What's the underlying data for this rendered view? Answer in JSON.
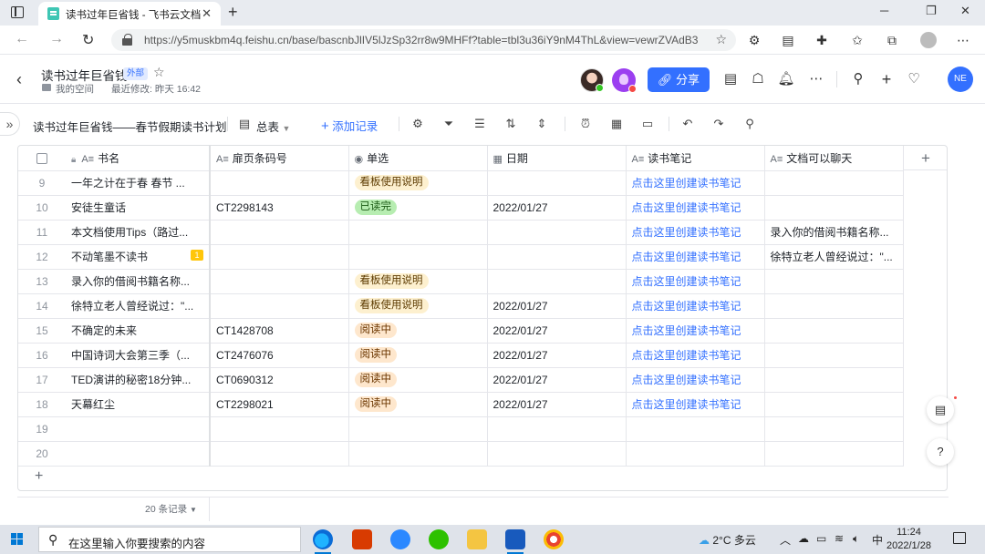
{
  "browser": {
    "tab_title": "读书过年巨省钱 - 飞书云文档",
    "tab_close": "✕",
    "new_tab": "+",
    "url_host": "https://y5muskbm4q.feishu.cn",
    "url_path": "/base/bascnbJlIV5lJzSp32rr8w9MHFf?table=tbl3u36iY9nM4ThL&view=vewrZVAdB3"
  },
  "header": {
    "title": "读书过年巨省钱",
    "badge": "外部",
    "location": "我的空间",
    "last_modified": "最近修改: 昨天 16:42",
    "share_label": "分享",
    "user_initials": "NE"
  },
  "toolbar": {
    "table_title": "读书过年巨省钱——春节假期读书计划",
    "view_name": "总表",
    "add_record": "添加记录"
  },
  "grid": {
    "columns": [
      {
        "icon": "A≡",
        "label": "书名"
      },
      {
        "icon": "A≡",
        "label": "扉页条码号"
      },
      {
        "icon": "◉",
        "label": "单选"
      },
      {
        "icon": "▦",
        "label": "日期"
      },
      {
        "icon": "A≡",
        "label": "读书笔记"
      },
      {
        "icon": "A≡",
        "label": "文档可以聊天"
      }
    ],
    "rows": [
      {
        "num": "9",
        "name": "一年之计在于春  春节 ...",
        "code": "",
        "tag": "看板使用说明",
        "date": "",
        "note": "点击这里创建读书笔记",
        "chat": ""
      },
      {
        "num": "10",
        "name": "安徒生童话",
        "code": "CT2298143",
        "tag": "已读完",
        "date": "2022/01/27",
        "note": "点击这里创建读书笔记",
        "chat": ""
      },
      {
        "num": "11",
        "name": "本文档使用Tips（路过...",
        "code": "",
        "tag": "",
        "date": "",
        "note": "点击这里创建读书笔记",
        "chat": "录入你的借阅书籍名称..."
      },
      {
        "num": "12",
        "name": "不动笔墨不读书",
        "code": "",
        "tag": "",
        "date": "",
        "note": "点击这里创建读书笔记",
        "chat": "徐特立老人曾经说过：\"...",
        "comments": "1"
      },
      {
        "num": "13",
        "name": "录入你的借阅书籍名称...",
        "code": "",
        "tag": "看板使用说明",
        "date": "",
        "note": "点击这里创建读书笔记",
        "chat": ""
      },
      {
        "num": "14",
        "name": "徐特立老人曾经说过：\"...",
        "code": "",
        "tag": "看板使用说明",
        "date": "2022/01/27",
        "note": "点击这里创建读书笔记",
        "chat": ""
      },
      {
        "num": "15",
        "name": "不确定的未来",
        "code": "CT1428708",
        "tag": "阅读中",
        "date": "2022/01/27",
        "note": "点击这里创建读书笔记",
        "chat": ""
      },
      {
        "num": "16",
        "name": "中国诗词大会第三季（...",
        "code": "CT2476076",
        "tag": "阅读中",
        "date": "2022/01/27",
        "note": "点击这里创建读书笔记",
        "chat": ""
      },
      {
        "num": "17",
        "name": "TED演讲的秘密18分钟...",
        "code": "CT0690312",
        "tag": "阅读中",
        "date": "2022/01/27",
        "note": "点击这里创建读书笔记",
        "chat": ""
      },
      {
        "num": "18",
        "name": "天幕红尘",
        "code": "CT2298021",
        "tag": "阅读中",
        "date": "2022/01/27",
        "note": "点击这里创建读书笔记",
        "chat": ""
      },
      {
        "num": "19",
        "name": "",
        "code": "",
        "tag": "",
        "date": "",
        "note": "",
        "chat": ""
      },
      {
        "num": "20",
        "name": "",
        "code": "",
        "tag": "",
        "date": "",
        "note": "",
        "chat": ""
      }
    ],
    "tag_colors": {
      "看板使用说明": {
        "bg": "#fdf0cf",
        "fg": "#5c3a00"
      },
      "已读完": {
        "bg": "#b7edb1",
        "fg": "#1d5b16"
      },
      "阅读中": {
        "bg": "#fee7cd",
        "fg": "#6b3600"
      }
    },
    "record_count": "20 条记录"
  },
  "taskbar": {
    "search_placeholder": "在这里输入你要搜索的内容",
    "weather": "2°C  多云",
    "ime": "中",
    "time": "11:24",
    "date": "2022/1/28"
  }
}
